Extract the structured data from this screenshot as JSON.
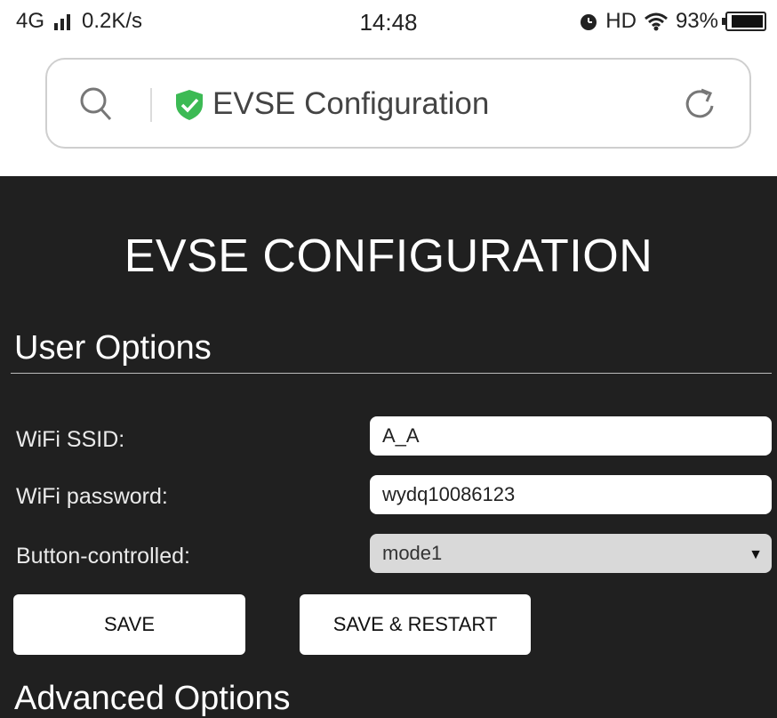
{
  "status_bar": {
    "network": "4G",
    "speed": "0.2K/s",
    "time": "14:48",
    "hd": "HD",
    "battery": "93%",
    "battery_level": 0.93
  },
  "address_bar": {
    "page_title": "EVSE Configuration",
    "secure_color": "#3cba54"
  },
  "page": {
    "title": "EVSE CONFIGURATION",
    "user_options": {
      "heading": "User Options",
      "ssid_label": "WiFi SSID:",
      "ssid_value": "A_A",
      "password_label": "WiFi password:",
      "password_value": "wydq10086123",
      "button_label": "Button-controlled:",
      "button_value": "mode1"
    },
    "buttons": {
      "save": "SAVE",
      "save_restart": "SAVE & RESTART"
    },
    "advanced_heading": "Advanced Options"
  }
}
